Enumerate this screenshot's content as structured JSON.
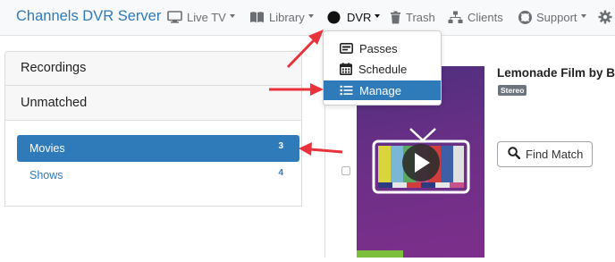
{
  "navbar": {
    "brand": "Channels DVR Server",
    "items": [
      {
        "label": "Live TV",
        "icon": "monitor-icon",
        "dropdown": true
      },
      {
        "label": "Library",
        "icon": "book-icon",
        "dropdown": true
      },
      {
        "label": "DVR",
        "icon": "record-icon",
        "dropdown": true,
        "active": true
      },
      {
        "label": "Trash",
        "icon": "trash-icon"
      },
      {
        "label": "Clients",
        "icon": "network-icon"
      },
      {
        "label": "Support",
        "icon": "lifebuoy-icon",
        "dropdown": true
      },
      {
        "label": "",
        "icon": "gear-icon"
      }
    ]
  },
  "dvr_menu": {
    "items": [
      {
        "label": "Passes",
        "icon": "pass-icon"
      },
      {
        "label": "Schedule",
        "icon": "calendar-icon"
      },
      {
        "label": "Manage",
        "icon": "list-icon",
        "active": true
      }
    ]
  },
  "sidebar": {
    "recordings_title": "Recordings",
    "unmatched_title": "Unmatched",
    "items": [
      {
        "label": "Movies",
        "count": "3",
        "selected": true
      },
      {
        "label": "Shows",
        "count": "4"
      }
    ]
  },
  "main": {
    "movie_title": "Lemonade Film by Be",
    "badge": "Stereo",
    "find_match_label": "Find Match"
  },
  "colors": {
    "accent": "#2f7ab8",
    "annotation_arrow": "#e8323c",
    "poster_purple": "#6a2f86"
  }
}
